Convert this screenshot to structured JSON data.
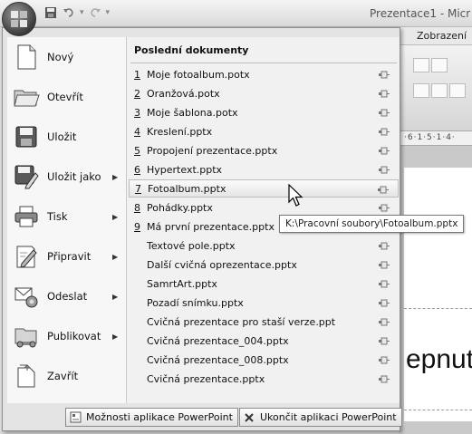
{
  "window": {
    "title": "Prezentace1 - Micr"
  },
  "tabs": {
    "zobrazeni": "Zobrazení"
  },
  "ruler": {
    "text": "·6·1·5·1·4·"
  },
  "slide": {
    "text": "epnut"
  },
  "menu": {
    "commands": [
      {
        "label": "Nový",
        "icon": "new-document-icon",
        "has_submenu": false
      },
      {
        "label": "Otevřít",
        "icon": "open-folder-icon",
        "has_submenu": false
      },
      {
        "label": "Uložit",
        "icon": "save-disk-icon",
        "has_submenu": false
      },
      {
        "label": "Uložit jako",
        "icon": "save-as-icon",
        "has_submenu": true
      },
      {
        "label": "Tisk",
        "icon": "printer-icon",
        "has_submenu": true
      },
      {
        "label": "Připravit",
        "icon": "prepare-icon",
        "has_submenu": true
      },
      {
        "label": "Odeslat",
        "icon": "send-icon",
        "has_submenu": true
      },
      {
        "label": "Publikovat",
        "icon": "publish-icon",
        "has_submenu": true
      },
      {
        "label": "Zavřít",
        "icon": "close-document-icon",
        "has_submenu": false
      }
    ],
    "recent_header": "Poslední dokumenty",
    "recent": [
      {
        "num": "1",
        "name": "Moje fotoalbum.potx"
      },
      {
        "num": "2",
        "name": "Oranžová.potx"
      },
      {
        "num": "3",
        "name": "Moje šablona.potx"
      },
      {
        "num": "4",
        "name": "Kreslení.pptx"
      },
      {
        "num": "5",
        "name": "Propojení prezentace.pptx"
      },
      {
        "num": "6",
        "name": "Hypertext.pptx"
      },
      {
        "num": "7",
        "name": "Fotoalbum.pptx"
      },
      {
        "num": "8",
        "name": "Pohádky.pptx"
      },
      {
        "num": "9",
        "name": "Má první prezentace.pptx"
      },
      {
        "num": "",
        "name": "Textové pole.pptx"
      },
      {
        "num": "",
        "name": "Další cvičná oprezentace.pptx"
      },
      {
        "num": "",
        "name": "SamrtArt.pptx"
      },
      {
        "num": "",
        "name": "Pozadí snímku.pptx"
      },
      {
        "num": "",
        "name": "Cvičná prezentace pro staší verze.ppt"
      },
      {
        "num": "",
        "name": "Cvičná prezentace_004.pptx"
      },
      {
        "num": "",
        "name": "Cvičná prezentace_008.pptx"
      },
      {
        "num": "",
        "name": "Cvičná prezentace.pptx"
      }
    ],
    "hovered_index": 6,
    "tooltip": "K:\\Pracovní soubory\\Fotoalbum.pptx",
    "options_button": "Možnosti aplikace PowerPoint",
    "exit_button": "Ukončit aplikaci PowerPoint"
  }
}
